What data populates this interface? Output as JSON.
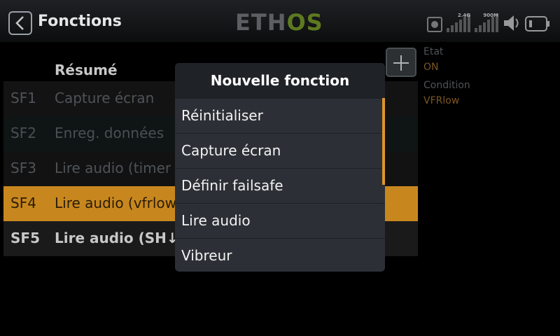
{
  "header": {
    "title": "Fonctions",
    "logo_left": "ETH",
    "logo_right": "OS",
    "status": {
      "record_icon": "record-icon",
      "signal_2g4_label": "2.4G",
      "signal_900m_label": "900M",
      "volume_icon": "speaker-icon",
      "battery_icon": "battery-icon"
    }
  },
  "table": {
    "header_label": "Résumé",
    "rows": [
      {
        "idx": "SF1",
        "name": "Capture écran"
      },
      {
        "idx": "SF2",
        "name": "Enreg. données"
      },
      {
        "idx": "SF3",
        "name": "Lire audio (timer"
      },
      {
        "idx": "SF4",
        "name": "Lire audio (vfrlow"
      },
      {
        "idx": "SF5",
        "name": "Lire audio (SH↓, t"
      }
    ]
  },
  "side": {
    "state_label": "Etat",
    "state_value": "ON",
    "condition_label": "Condition",
    "condition_value": "VFRlow"
  },
  "dialog": {
    "title": "Nouvelle fonction",
    "options": [
      "Réinitialiser",
      "Capture écran",
      "Définir failsafe",
      "Lire audio",
      "Vibreur"
    ]
  },
  "colors": {
    "accent": "#c8871e",
    "logo_green": "#5e7a1f"
  }
}
